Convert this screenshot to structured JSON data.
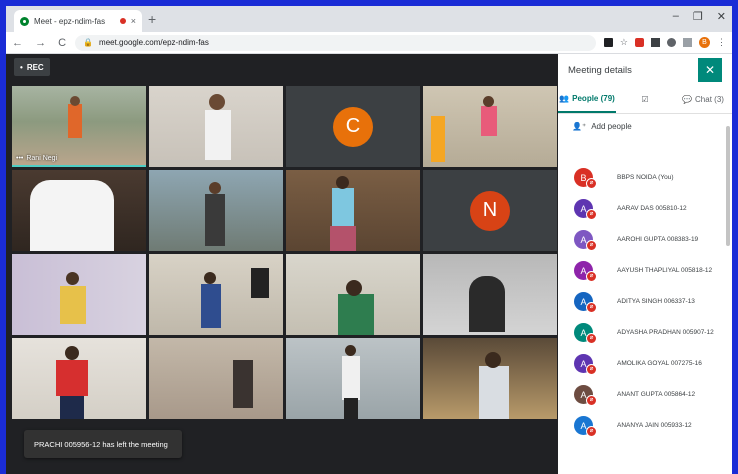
{
  "browser": {
    "tab_title": "Meet - epz-ndim-fas",
    "tab_close": "×",
    "new_tab": "+",
    "win_min": "–",
    "win_max": "❐",
    "win_close": "✕",
    "back": "←",
    "forward": "→",
    "reload": "C",
    "url": "meet.google.com/epz-ndim-fas",
    "profile_initial": "B",
    "menu": "⋮"
  },
  "meet": {
    "rec_label": "REC",
    "active_speaker": "Rani Negi",
    "tile_letters": {
      "c": {
        "letter": "C",
        "color": "#e8710a"
      },
      "n": {
        "letter": "N",
        "color": "#d84315"
      }
    },
    "toast": "PRACHI 005956-12 has left the meeting"
  },
  "panel": {
    "title": "Meeting details",
    "close": "✕",
    "tabs": {
      "people": "People (79)",
      "chat": "Chat (3)"
    },
    "add_people": "Add people",
    "participants": [
      {
        "initial": "B",
        "name": "BBPS NOIDA (You)",
        "color": "#d93025"
      },
      {
        "initial": "A",
        "name": "AARAV DAS 005810-12",
        "color": "#5e35b1"
      },
      {
        "initial": "A",
        "name": "AAROHI GUPTA 008383-19",
        "color": "#7e57c2"
      },
      {
        "initial": "A",
        "name": "AAYUSH THAPLIYAL 005818-12",
        "color": "#8e24aa"
      },
      {
        "initial": "A",
        "name": "ADITYA SINGH 006337-13",
        "color": "#1565c0"
      },
      {
        "initial": "A",
        "name": "ADYASHA PRADHAN 005907-12",
        "color": "#00897b"
      },
      {
        "initial": "A",
        "name": "AMOLIKA GOYAL 007275-16",
        "color": "#5e35b1"
      },
      {
        "initial": "A",
        "name": "ANANT GUPTA 005864-12",
        "color": "#6d4c41"
      },
      {
        "initial": "A",
        "name": "ANANYA JAIN 005933-12",
        "color": "#1976d2"
      }
    ]
  }
}
